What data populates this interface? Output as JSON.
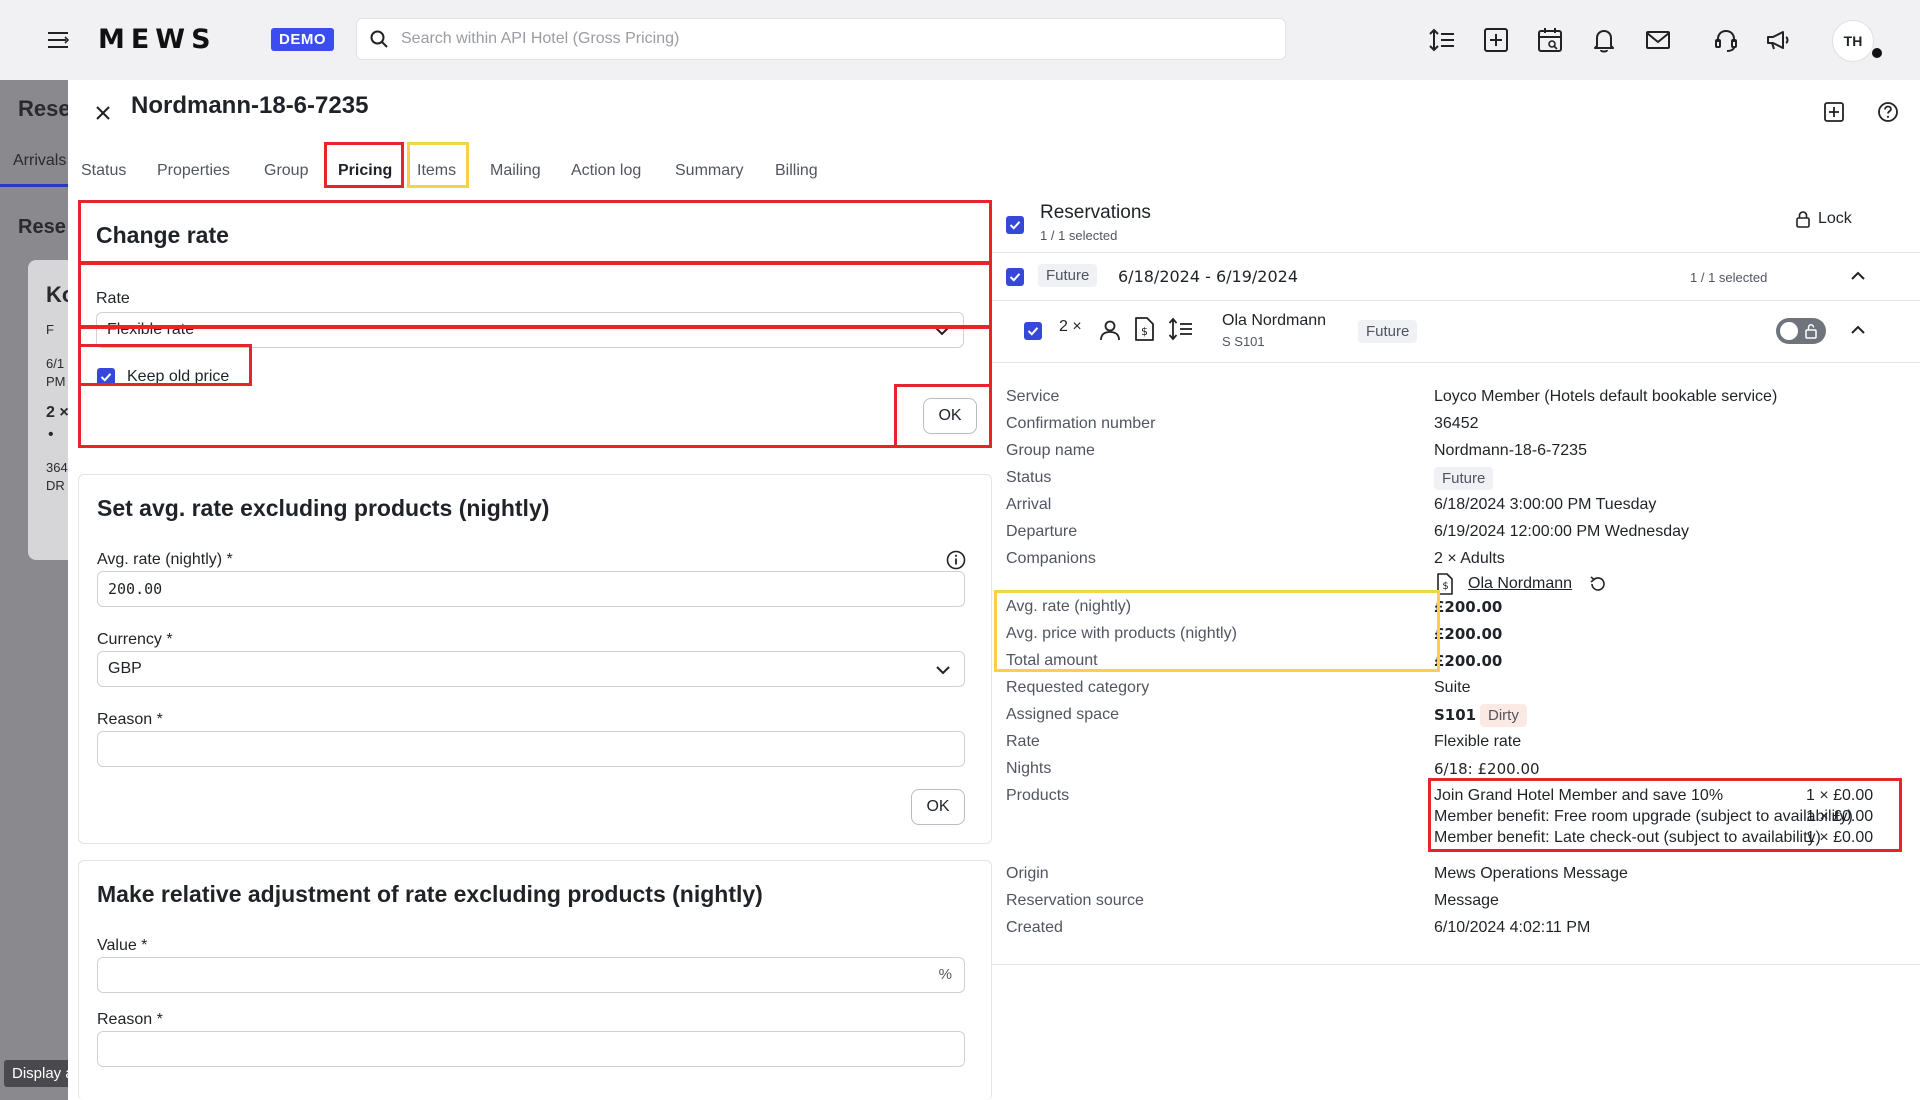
{
  "topbar": {
    "logo": "MEWS",
    "demo_badge": "DEMO",
    "search_placeholder": "Search within API Hotel (Gross Pricing)",
    "avatar_initials": "TH"
  },
  "background": {
    "title": "Rese",
    "tab": "Arrivals",
    "subtitle": "Rese",
    "card_lines": [
      "Ko",
      "F",
      "6/1",
      "PM",
      "2 ×",
      "•",
      "364",
      "DR"
    ]
  },
  "tooltip": "Display a menu",
  "modal": {
    "title": "Nordmann-18-6-7235",
    "tabs": [
      "Status",
      "Properties",
      "Group",
      "Pricing",
      "Items",
      "Mailing",
      "Action log",
      "Summary",
      "Billing"
    ],
    "active_tab": "Pricing"
  },
  "change_rate": {
    "title": "Change rate",
    "rate_label": "Rate",
    "rate_value": "Flexible rate",
    "keep_old_price_label": "Keep old price",
    "keep_old_price_checked": true,
    "ok_label": "OK"
  },
  "set_avg_rate": {
    "title": "Set avg. rate excluding products (nightly)",
    "avg_rate_label": "Avg. rate (nightly) *",
    "avg_rate_value": "200.00",
    "currency_label": "Currency *",
    "currency_value": "GBP",
    "reason_label": "Reason *",
    "reason_value": "",
    "ok_label": "OK"
  },
  "relative_adjustment": {
    "title": "Make relative adjustment of rate excluding products (nightly)",
    "value_label": "Value *",
    "value_value": "",
    "value_suffix": "%",
    "reason_label": "Reason *",
    "reason_value": ""
  },
  "reservations": {
    "title": "Reservations",
    "selected": "1 / 1 selected",
    "lock_label": "Lock",
    "group_status": "Future",
    "group_dates": "6/18/2024 - 6/19/2024",
    "group_selected": "1 / 1 selected",
    "item_count": "2 ×",
    "guest_name": "Ola Nordmann",
    "guest_space": "S S101",
    "item_status": "Future"
  },
  "details": {
    "service_label": "Service",
    "service_value": "Loyco Member (Hotels default bookable service)",
    "confirmation_label": "Confirmation number",
    "confirmation_value": "36452",
    "group_name_label": "Group name",
    "group_name_value": "Nordmann-18-6-7235",
    "status_label": "Status",
    "status_value": "Future",
    "arrival_label": "Arrival",
    "arrival_value": "6/18/2024 3:00:00 PM Tuesday",
    "departure_label": "Departure",
    "departure_value": "6/19/2024 12:00:00 PM Wednesday",
    "companions_label": "Companions",
    "companions_value": "2 × Adults",
    "companion_name": "Ola Nordmann",
    "avg_rate_label": "Avg. rate (nightly)",
    "avg_rate_value": "£200.00",
    "avg_price_label": "Avg. price with products (nightly)",
    "avg_price_value": "£200.00",
    "total_label": "Total amount",
    "total_value": "£200.00",
    "requested_category_label": "Requested category",
    "requested_category_value": "Suite",
    "assigned_space_label": "Assigned space",
    "assigned_space_value": "S101",
    "assigned_space_state": "Dirty",
    "rate_label": "Rate",
    "rate_value": "Flexible rate",
    "nights_label": "Nights",
    "nights_value": "6/18: £200.00",
    "products_label": "Products",
    "products": [
      {
        "name": "Join Grand Hotel Member and save 10%",
        "qty": "1 × £0.00"
      },
      {
        "name": "Member benefit: Free room upgrade (subject to availability)",
        "qty": "1 × £0.00"
      },
      {
        "name": "Member benefit: Late check-out (subject to availability)",
        "qty": "1 × £0.00"
      }
    ],
    "origin_label": "Origin",
    "origin_value": "Mews Operations Message",
    "source_label": "Reservation source",
    "source_value": "Message",
    "created_label": "Created",
    "created_value": "6/10/2024 4:02:11 PM"
  },
  "colors": {
    "accent": "#3548d8",
    "demo_badge": "#3b4cf0",
    "highlight_red": "#e5252a",
    "highlight_yellow": "#f5d24a",
    "topbar_bg": "#f1f1f3"
  }
}
